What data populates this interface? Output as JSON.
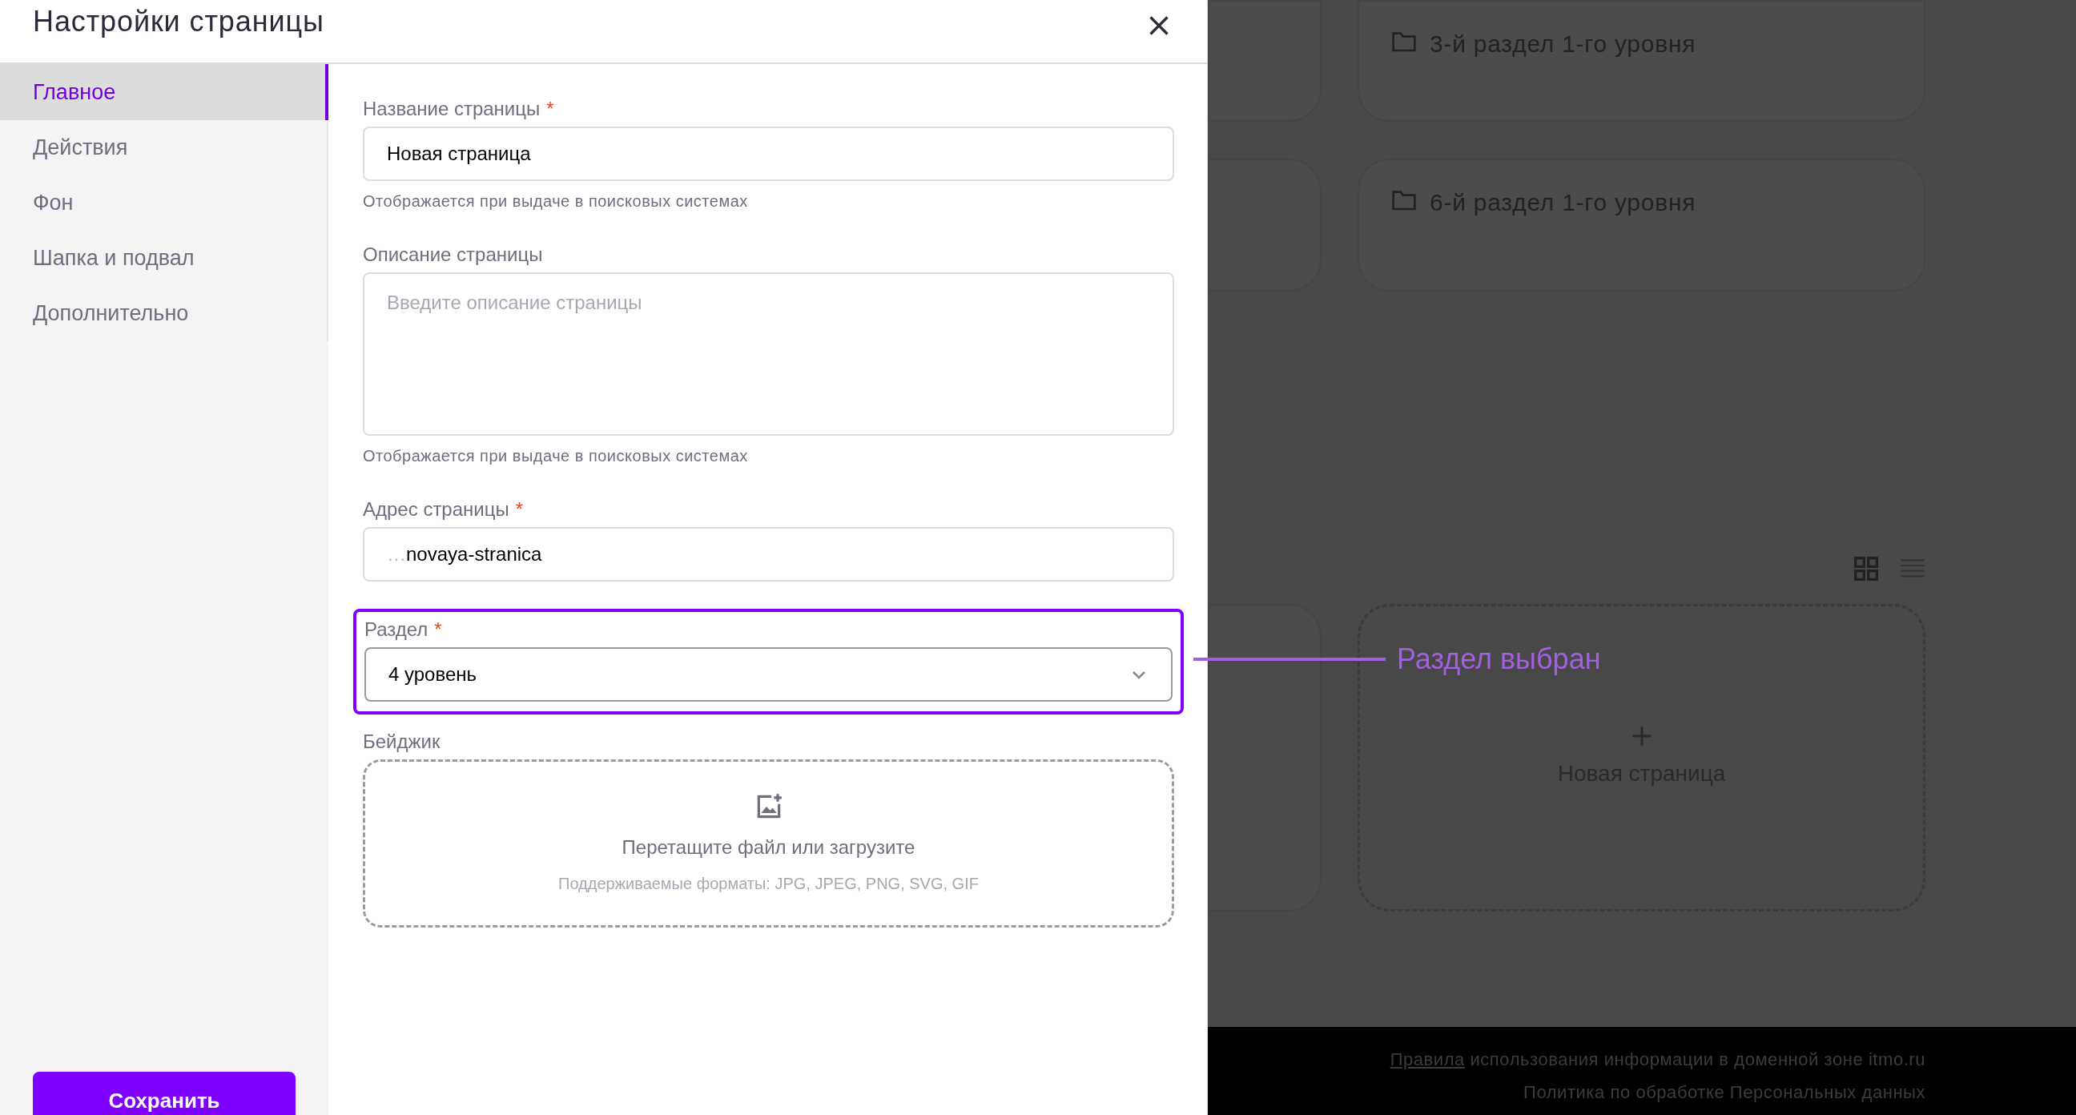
{
  "dialog": {
    "title": "Настройки страницы"
  },
  "sidebar": {
    "items": [
      {
        "label": "Главное",
        "selected": true
      },
      {
        "label": "Действия",
        "selected": false
      },
      {
        "label": "Фон",
        "selected": false
      },
      {
        "label": "Шапка и подвал",
        "selected": false
      },
      {
        "label": "Дополнительно",
        "selected": false
      }
    ]
  },
  "save_button": "Сохранить",
  "form": {
    "fields": [
      {
        "kind": "input",
        "label": "Название страницы",
        "required_mark": "*",
        "value": "Новая страница",
        "hint": "Отображается при выдаче в поисковых системах"
      },
      {
        "kind": "textarea",
        "label": "Описание страницы",
        "placeholder": "Введите описание страницы",
        "hint": "Отображается при выдаче в поисковых системах"
      },
      {
        "kind": "input",
        "label": "Адрес страницы",
        "required_mark": "*",
        "prefix": "…",
        "value": "novaya-stranica"
      },
      {
        "kind": "select",
        "label": "Раздел",
        "required_mark": "*",
        "value": "4 уровень",
        "highlighted": true
      },
      {
        "kind": "upload",
        "label": "Бейджик",
        "text": "Перетащите файл или загрузите",
        "formats": "Поддерживаемые форматы: JPG, JPEG, PNG, SVG, GIF"
      }
    ]
  },
  "annotation": "Раздел выбран",
  "background": {
    "rows": [
      [
        {
          "kind": "card"
        },
        {
          "kind": "folder",
          "title": "3-й раздел 1-го уровня"
        }
      ],
      [
        {
          "kind": "card"
        },
        {
          "kind": "folder",
          "title": "6-й раздел 1-го уровня"
        }
      ],
      [
        {
          "kind": "card"
        },
        {
          "kind": "new",
          "title": "Новая страница"
        }
      ]
    ],
    "footer": {
      "link": "Правила",
      "text": "использования информации в доменной зоне itmo.ru",
      "line2": "Политика по обработке Персональных данных"
    }
  }
}
